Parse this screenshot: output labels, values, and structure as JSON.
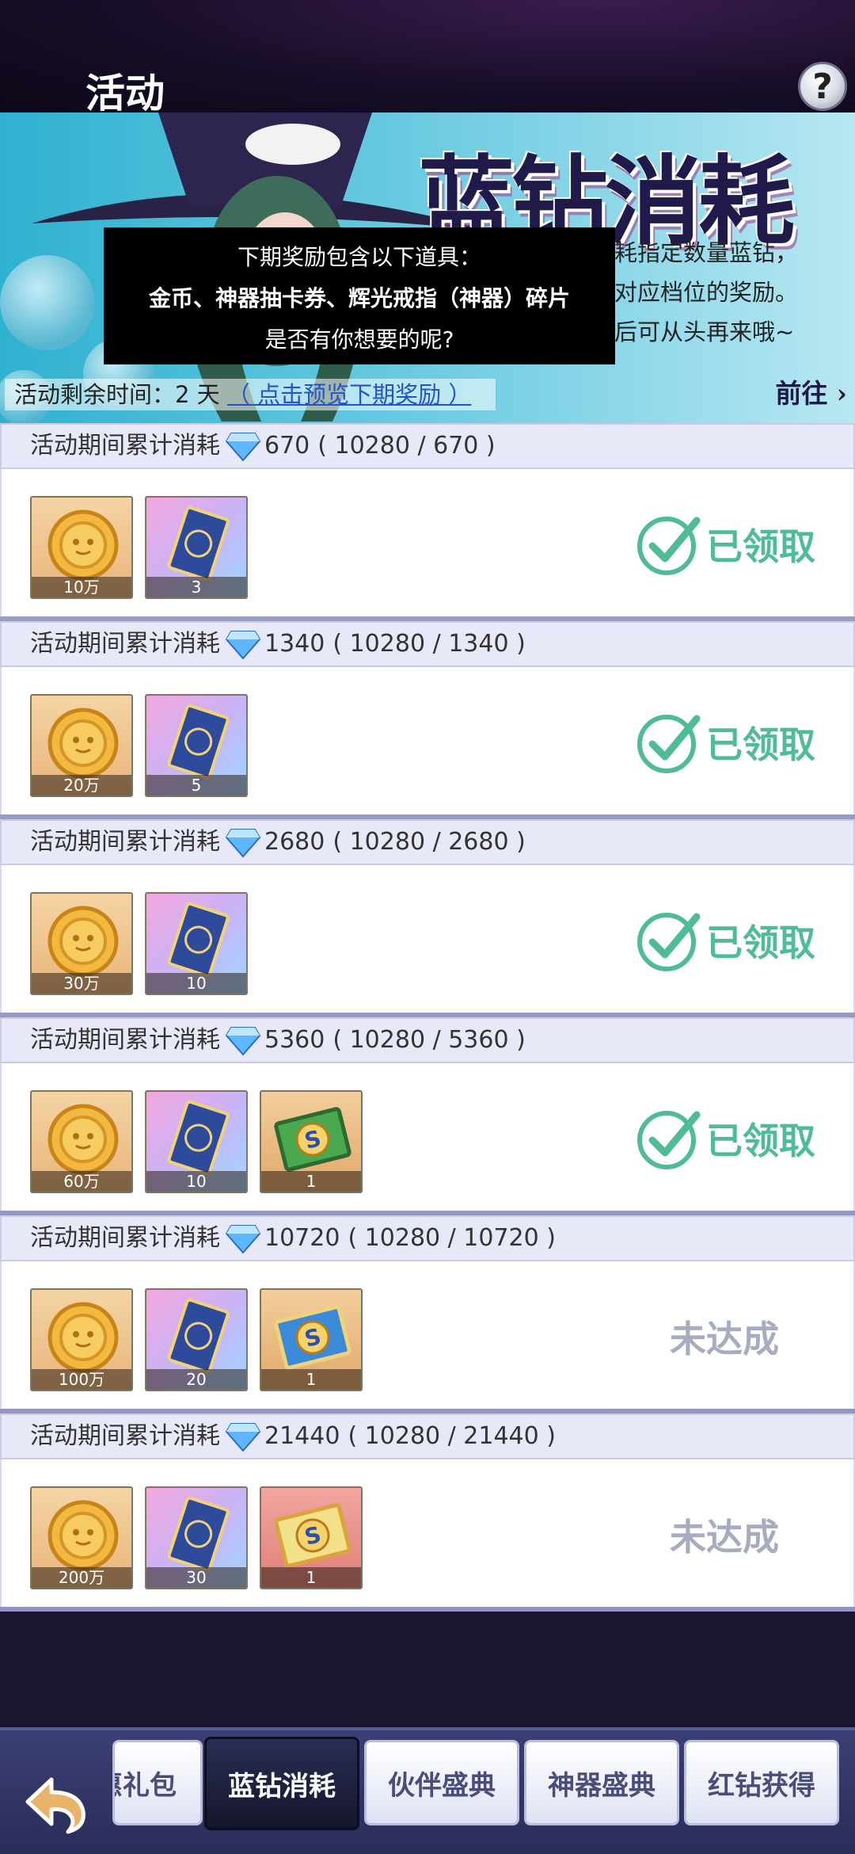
{
  "header": {
    "title": "活动",
    "help_icon": "question-icon"
  },
  "banner": {
    "headline": "蓝钻消耗",
    "desc_lines": [
      "耗指定数量蓝钻，",
      "对应档位的奖励。",
      "后可从头再来哦~"
    ],
    "tooltip": {
      "line1": "下期奖励包含以下道具：",
      "line2": "金币、神器抽卡券、辉光戒指（神器）碎片",
      "line3": "是否有你想要的呢?"
    },
    "timer_label": "活动剩余时间：2 天",
    "timer_link": "（ 点击预览下期奖励 ）",
    "goto_label": "前往 ›"
  },
  "tier_label": "活动期间累计消耗",
  "tiers": [
    {
      "amount": "670",
      "progress": "( 10280 / 670 )",
      "status": "已领取",
      "items": [
        {
          "type": "coin",
          "qty": "10万"
        },
        {
          "type": "card",
          "qty": "3"
        }
      ]
    },
    {
      "amount": "1340",
      "progress": "( 10280 / 1340 )",
      "status": "已领取",
      "items": [
        {
          "type": "coin",
          "qty": "20万"
        },
        {
          "type": "card",
          "qty": "5"
        }
      ]
    },
    {
      "amount": "2680",
      "progress": "( 10280 / 2680 )",
      "status": "已领取",
      "items": [
        {
          "type": "coin",
          "qty": "30万"
        },
        {
          "type": "card",
          "qty": "10"
        }
      ]
    },
    {
      "amount": "5360",
      "progress": "( 10280 / 5360 )",
      "status": "已领取",
      "items": [
        {
          "type": "coin",
          "qty": "60万"
        },
        {
          "type": "card",
          "qty": "10"
        },
        {
          "type": "ticket-green",
          "qty": "1"
        }
      ]
    },
    {
      "amount": "10720",
      "progress": "( 10280 / 10720 )",
      "status": "未达成",
      "items": [
        {
          "type": "coin",
          "qty": "100万"
        },
        {
          "type": "card",
          "qty": "20"
        },
        {
          "type": "ticket-blue",
          "qty": "1"
        }
      ]
    },
    {
      "amount": "21440",
      "progress": "( 10280 / 21440 )",
      "status": "未达成",
      "items": [
        {
          "type": "coin",
          "qty": "200万"
        },
        {
          "type": "card",
          "qty": "30"
        },
        {
          "type": "ticket-red",
          "qty": "1"
        }
      ]
    }
  ],
  "tabs": [
    {
      "label": "惠礼包",
      "active": false
    },
    {
      "label": "蓝钻消耗",
      "active": true
    },
    {
      "label": "伙伴盛典",
      "active": false
    },
    {
      "label": "神器盛典",
      "active": false
    },
    {
      "label": "红钻获得",
      "active": false
    }
  ],
  "colors": {
    "claimed": "#4fbc96",
    "pending": "#a8acc0",
    "accent": "#2255c8"
  }
}
